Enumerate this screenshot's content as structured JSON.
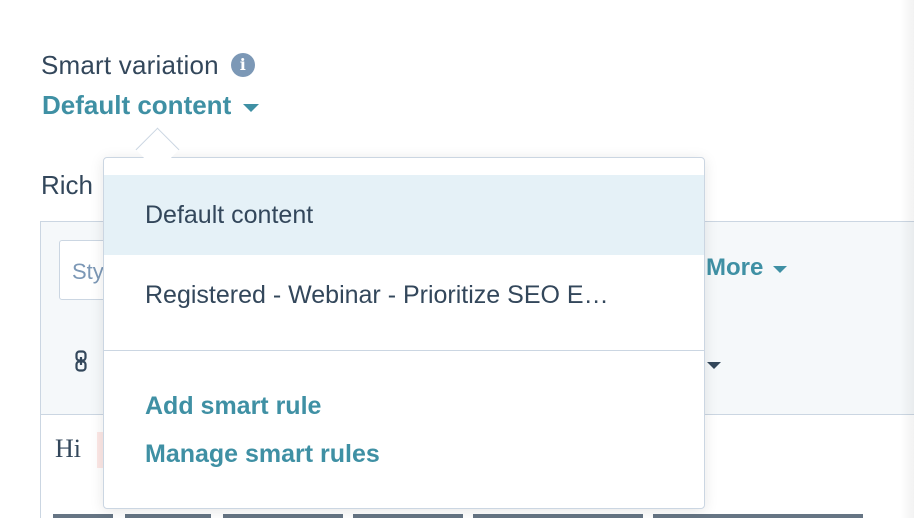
{
  "smart_variation": {
    "label": "Smart variation",
    "info_icon": "info-icon",
    "selected": "Default content"
  },
  "rich_text": {
    "label": "Rich",
    "style_placeholder": "Sty",
    "more_label": "More",
    "greeting": "Hi"
  },
  "dropdown": {
    "options": [
      {
        "label": "Default content",
        "selected": true
      },
      {
        "label": "Registered - Webinar - Prioritize SEO E…",
        "selected": false
      }
    ],
    "actions": {
      "add": "Add smart rule",
      "manage": "Manage smart rules"
    }
  },
  "colors": {
    "accent": "#3f90a4",
    "text": "#33475b",
    "border": "#cbd6e2",
    "selected_bg": "#e5f1f7"
  }
}
